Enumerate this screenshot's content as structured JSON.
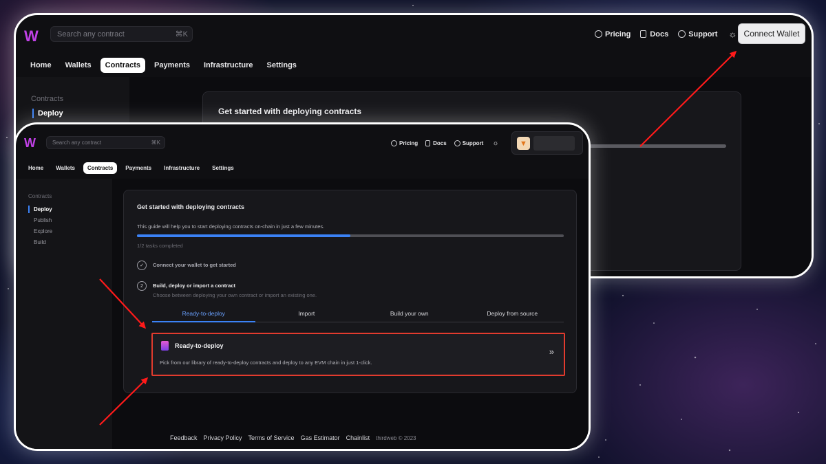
{
  "app": {
    "logo_glyph": "W",
    "brand_color": "#c041e6",
    "accent_color": "#3b82f6",
    "highlight_color": "#e23b2e"
  },
  "search": {
    "placeholder": "Search any contract",
    "shortcut": "⌘K"
  },
  "header": {
    "pricing_label": "Pricing",
    "docs_label": "Docs",
    "support_label": "Support",
    "theme_icon": "sun-icon",
    "connect_wallet_label": "Connect Wallet",
    "wallet_icon": "metamask-fox-icon"
  },
  "nav_tabs": [
    "Home",
    "Wallets",
    "Contracts",
    "Payments",
    "Infrastructure",
    "Settings"
  ],
  "active_tab": "Contracts",
  "sidebar": {
    "section": "Contracts",
    "items": [
      "Deploy",
      "Publish",
      "Explore",
      "Build"
    ],
    "active_item": "Deploy"
  },
  "guide": {
    "title": "Get started with deploying contracts",
    "description": "This guide will help you to start deploying contracts on-chain in just a few minutes.",
    "progress_fraction": 0.5,
    "tasks_completed": "1/2 tasks completed",
    "steps": [
      {
        "badge": "✓",
        "title": "Connect your wallet to get started",
        "description": ""
      },
      {
        "badge": "2",
        "title": "Build, deploy or import a contract",
        "description": "Choose between deploying your own contract or import an existing one."
      }
    ],
    "subtabs": [
      "Ready-to-deploy",
      "Import",
      "Build your own",
      "Deploy from source"
    ],
    "active_subtab": "Ready-to-deploy",
    "option": {
      "title": "Ready-to-deploy",
      "description": "Pick from our library of ready-to-deploy contracts and deploy to any EVM chain in just 1-click.",
      "arrow": "»"
    }
  },
  "footer": {
    "links": [
      "Feedback",
      "Privacy Policy",
      "Terms of Service",
      "Gas Estimator",
      "Chainlist"
    ],
    "copyright": "thirdweb © 2023"
  }
}
